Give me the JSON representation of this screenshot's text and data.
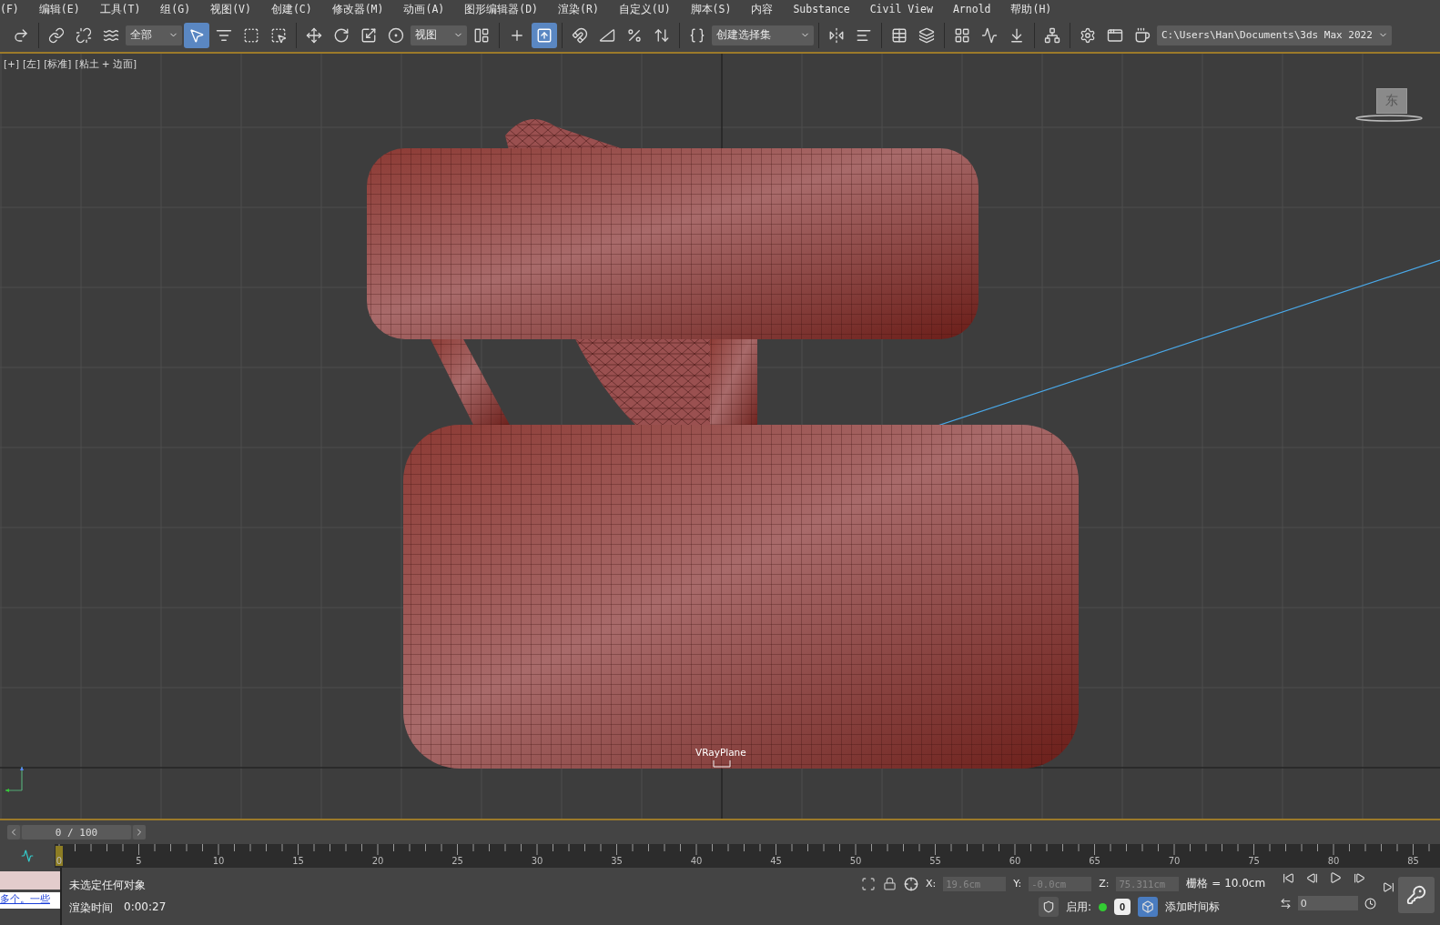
{
  "menu": [
    "(F)",
    "编辑(E)",
    "工具(T)",
    "组(G)",
    "视图(V)",
    "创建(C)",
    "修改器(M)",
    "动画(A)",
    "图形编辑器(D)",
    "渲染(R)",
    "自定义(U)",
    "脚本(S)",
    "内容",
    "Substance",
    "Civil View",
    "Arnold",
    "帮助(H)"
  ],
  "toolbar": [
    [
      {
        "kind": "button",
        "selected": false
      }
    ],
    [
      {
        "kind": "button",
        "selected": false
      },
      {
        "kind": "button",
        "selected": false
      },
      {
        "kind": "button",
        "selected": false
      },
      {
        "kind": "dropdown",
        "value": "全部"
      },
      {
        "kind": "button",
        "selected": true
      },
      {
        "kind": "button",
        "selected": false
      },
      {
        "kind": "button",
        "selected": false
      },
      {
        "kind": "button",
        "selected": false
      }
    ],
    [
      {
        "kind": "button",
        "selected": false
      },
      {
        "kind": "button",
        "selected": false
      },
      {
        "kind": "button",
        "selected": false
      },
      {
        "kind": "button",
        "selected": false
      },
      {
        "kind": "dropdown",
        "value": "视图"
      },
      {
        "kind": "button",
        "selected": false
      }
    ],
    [
      {
        "kind": "button",
        "selected": false
      },
      {
        "kind": "button",
        "selected": true
      }
    ],
    [
      {
        "kind": "button",
        "selected": false
      },
      {
        "kind": "button",
        "selected": false
      },
      {
        "kind": "button",
        "selected": false
      },
      {
        "kind": "button",
        "selected": false
      }
    ],
    [
      {
        "kind": "button",
        "selected": false
      },
      {
        "kind": "dropdown",
        "value": "创建选择集"
      }
    ],
    [
      {
        "kind": "button",
        "selected": false
      },
      {
        "kind": "button",
        "selected": false
      }
    ],
    [
      {
        "kind": "button",
        "selected": false
      },
      {
        "kind": "button",
        "selected": false
      }
    ],
    [
      {
        "kind": "button",
        "selected": false
      },
      {
        "kind": "button",
        "selected": false
      },
      {
        "kind": "button",
        "selected": false
      }
    ],
    [
      {
        "kind": "button",
        "selected": false
      }
    ],
    [
      {
        "kind": "button",
        "selected": false
      },
      {
        "kind": "button",
        "selected": false
      },
      {
        "kind": "button",
        "selected": false
      },
      {
        "kind": "dropdown",
        "value": "C:\\Users\\Han\\Documents\\3ds Max 2022"
      }
    ]
  ],
  "viewport": {
    "labels": [
      "[+]",
      "[左]",
      "[标准]",
      "[粘土 + 边面]"
    ],
    "viewcube": "东",
    "object_label": "VRayPlane"
  },
  "time_slider": {
    "text": "0 / 100",
    "level": 0
  },
  "trackbar": {
    "labels": [
      "0",
      "5",
      "10",
      "15",
      "20",
      "25",
      "30",
      "35",
      "40",
      "45",
      "50",
      "55",
      "60",
      "65",
      "70",
      "75",
      "80",
      "85"
    ]
  },
  "status": {
    "listener_text": "多个。一些",
    "selection": "未选定任何对象",
    "render_time_label": "渲染时间",
    "render_time": "0:00:27",
    "x_label": "X:",
    "x": "19.6cm",
    "y_label": "Y:",
    "y": "-0.0cm",
    "z_label": "Z:",
    "z": "75.311cm",
    "grid": "栅格 = 10.0cm",
    "enable_label": "启用:",
    "enable_on": true,
    "adaptive": "0",
    "time_tag": "添加时间标",
    "frame": "0"
  }
}
